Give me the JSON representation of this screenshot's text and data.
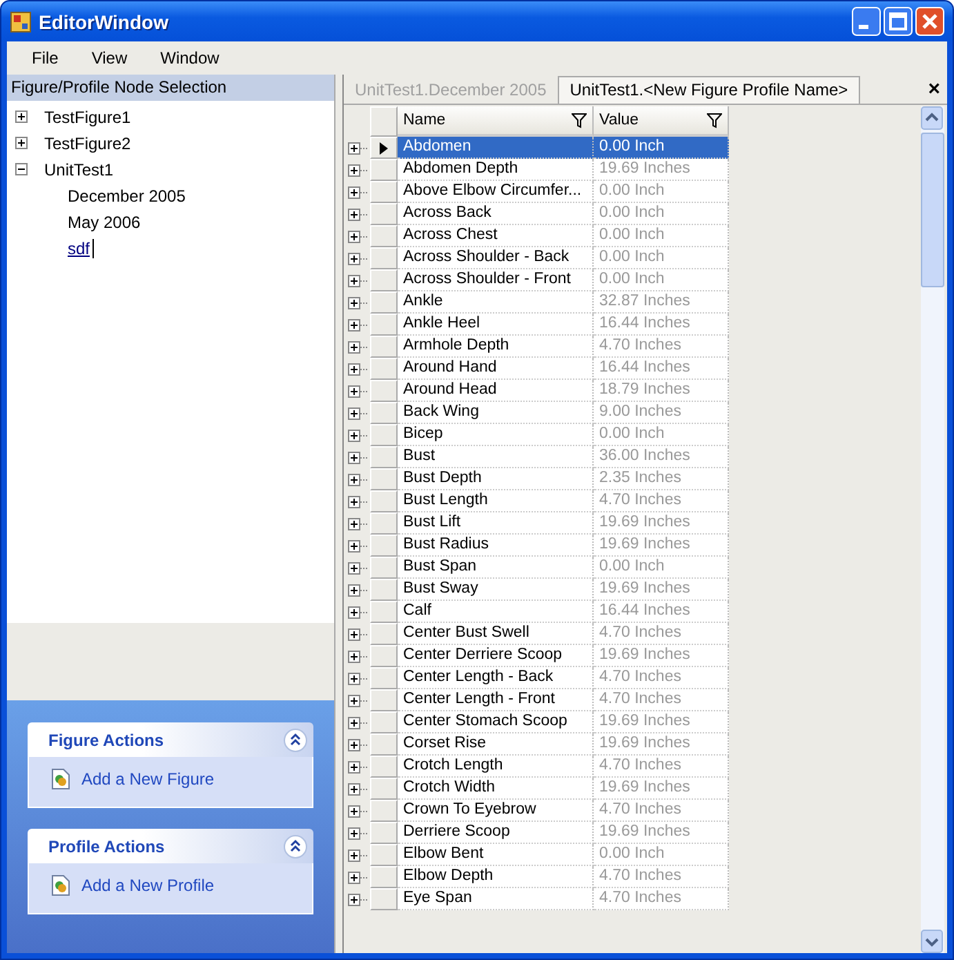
{
  "window": {
    "title": "EditorWindow"
  },
  "menu": [
    "File",
    "View",
    "Window"
  ],
  "tree": {
    "title": "Figure/Profile Node Selection",
    "items": [
      {
        "label": "TestFigure1",
        "expanded": false,
        "selected": false
      },
      {
        "label": "TestFigure2",
        "expanded": false,
        "selected": false
      },
      {
        "label": "UnitTest1",
        "expanded": true,
        "selected": false,
        "children": [
          {
            "label": "December 2005",
            "selected": false
          },
          {
            "label": "May 2006",
            "selected": false
          },
          {
            "label": "sdf",
            "selected": true
          }
        ]
      }
    ]
  },
  "task_groups": [
    {
      "title": "Figure Actions",
      "expanded": true,
      "items": [
        "Add a New Figure"
      ]
    },
    {
      "title": "Profile Actions",
      "expanded": true,
      "items": [
        "Add a New Profile"
      ]
    }
  ],
  "tabs": [
    {
      "label": "UnitTest1.December 2005",
      "selected": false
    },
    {
      "label": "UnitTest1.<New Figure Profile Name>",
      "selected": true
    }
  ],
  "close_tab": "×",
  "grid": {
    "columns": [
      "Name",
      "Value"
    ],
    "rows": [
      {
        "name": "Abdomen",
        "value": "0.00 Inch",
        "selected": true
      },
      {
        "name": "Abdomen Depth",
        "value": "19.69 Inches",
        "selected": false
      },
      {
        "name": "Above Elbow Circumfer...",
        "value": "0.00 Inch",
        "selected": false
      },
      {
        "name": "Across Back",
        "value": "0.00 Inch",
        "selected": false
      },
      {
        "name": "Across Chest",
        "value": "0.00 Inch",
        "selected": false
      },
      {
        "name": "Across Shoulder - Back",
        "value": "0.00 Inch",
        "selected": false
      },
      {
        "name": "Across Shoulder - Front",
        "value": "0.00 Inch",
        "selected": false
      },
      {
        "name": "Ankle",
        "value": "32.87 Inches",
        "selected": false
      },
      {
        "name": "Ankle Heel",
        "value": "16.44 Inches",
        "selected": false
      },
      {
        "name": "Armhole Depth",
        "value": "4.70 Inches",
        "selected": false
      },
      {
        "name": "Around Hand",
        "value": "16.44 Inches",
        "selected": false
      },
      {
        "name": "Around Head",
        "value": "18.79 Inches",
        "selected": false
      },
      {
        "name": "Back Wing",
        "value": "9.00 Inches",
        "selected": false
      },
      {
        "name": "Bicep",
        "value": "0.00 Inch",
        "selected": false
      },
      {
        "name": "Bust",
        "value": "36.00 Inches",
        "selected": false
      },
      {
        "name": "Bust Depth",
        "value": "2.35 Inches",
        "selected": false
      },
      {
        "name": "Bust Length",
        "value": "4.70 Inches",
        "selected": false
      },
      {
        "name": "Bust Lift",
        "value": "19.69 Inches",
        "selected": false
      },
      {
        "name": "Bust Radius",
        "value": "19.69 Inches",
        "selected": false
      },
      {
        "name": "Bust Span",
        "value": "0.00 Inch",
        "selected": false
      },
      {
        "name": "Bust Sway",
        "value": "19.69 Inches",
        "selected": false
      },
      {
        "name": "Calf",
        "value": "16.44 Inches",
        "selected": false
      },
      {
        "name": "Center Bust Swell",
        "value": "4.70 Inches",
        "selected": false
      },
      {
        "name": "Center Derriere Scoop",
        "value": "19.69 Inches",
        "selected": false
      },
      {
        "name": "Center Length - Back",
        "value": "4.70 Inches",
        "selected": false
      },
      {
        "name": "Center Length - Front",
        "value": "4.70 Inches",
        "selected": false
      },
      {
        "name": "Center Stomach Scoop",
        "value": "19.69 Inches",
        "selected": false
      },
      {
        "name": "Corset Rise",
        "value": "19.69 Inches",
        "selected": false
      },
      {
        "name": "Crotch Length",
        "value": "4.70 Inches",
        "selected": false
      },
      {
        "name": "Crotch Width",
        "value": "19.69 Inches",
        "selected": false
      },
      {
        "name": "Crown To Eyebrow",
        "value": "4.70 Inches",
        "selected": false
      },
      {
        "name": "Derriere Scoop",
        "value": "19.69 Inches",
        "selected": false
      },
      {
        "name": "Elbow Bent",
        "value": "0.00 Inch",
        "selected": false
      },
      {
        "name": "Elbow Depth",
        "value": "4.70 Inches",
        "selected": false
      },
      {
        "name": "Eye Span",
        "value": "4.70 Inches",
        "selected": false
      }
    ]
  }
}
